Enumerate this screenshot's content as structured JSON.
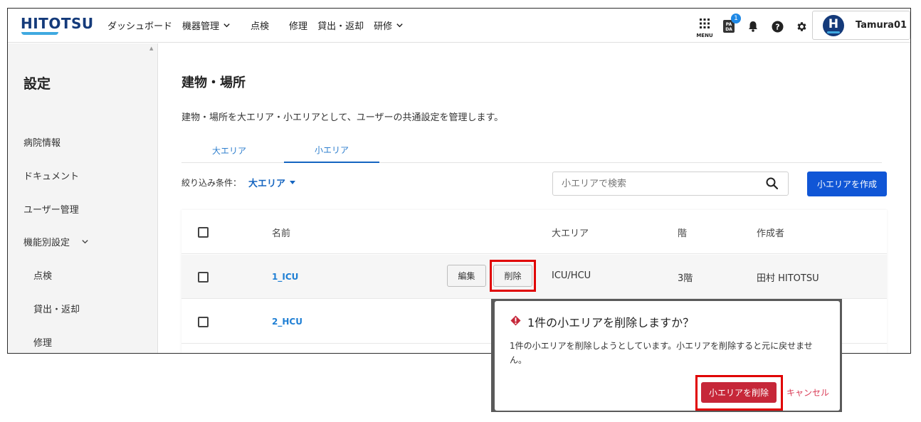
{
  "header": {
    "logo": "HITOTSU",
    "nav": [
      {
        "label": "ダッシュボード",
        "dropdown": false
      },
      {
        "label": "機器管理",
        "dropdown": true
      },
      {
        "label": "点検",
        "dropdown": false
      },
      {
        "label": "修理",
        "dropdown": false
      },
      {
        "label": "貸出・返却",
        "dropdown": false
      },
      {
        "label": "研修",
        "dropdown": true
      }
    ],
    "menu_label": "MENU",
    "notification_badge": "1",
    "pda_icon_text": "PA DA",
    "user": {
      "initial": "H",
      "name": "Tamura01"
    }
  },
  "sidebar": {
    "title": "設定",
    "items": [
      {
        "label": "病院情報"
      },
      {
        "label": "ドキュメント"
      },
      {
        "label": "ユーザー管理"
      },
      {
        "label": "機能別設定",
        "expanded": true
      },
      {
        "label": "点検",
        "sub": true
      },
      {
        "label": "貸出・返却",
        "sub": true
      },
      {
        "label": "修理",
        "sub": true
      }
    ]
  },
  "main": {
    "title": "建物・場所",
    "description": "建物・場所を大エリア・小エリアとして、ユーザーの共通設定を管理します。",
    "tabs": [
      {
        "label": "大エリア",
        "active": false
      },
      {
        "label": "小エリア",
        "active": true
      }
    ],
    "filter": {
      "label": "絞り込み条件：",
      "value": "大エリア"
    },
    "search": {
      "placeholder": "小エリアで検索"
    },
    "create_button": "小エリアを作成",
    "table": {
      "headers": [
        "名前",
        "大エリア",
        "階",
        "作成者"
      ],
      "rows": [
        {
          "name": "1_ICU",
          "area": "ICU/HCU",
          "floor": "3階",
          "creator": "田村 HITOTSU",
          "edit": "編集",
          "delete": "削除"
        },
        {
          "name": "2_HCU",
          "area": "",
          "floor": "",
          "creator": ""
        }
      ]
    }
  },
  "dialog": {
    "title": "1件の小エリアを削除しますか？",
    "body": "1件の小エリアを削除しようとしています。小エリアを削除すると元に戻せません。",
    "confirm": "小エリアを削除",
    "cancel": "キャンセル"
  },
  "colors": {
    "brand": "#143a7a",
    "primary": "#1056d6",
    "link": "#1f7fd4",
    "danger": "#c62739",
    "highlight": "#e00000"
  }
}
